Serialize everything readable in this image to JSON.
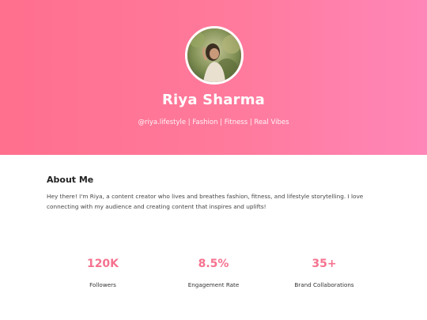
{
  "profile": {
    "name": "Riya Sharma",
    "tagline": "@riya.lifestyle | Fashion | Fitness | Real Vibes",
    "avatar_alt": "avatar photo"
  },
  "about": {
    "title": "About Me",
    "text": "Hey there! I'm Riya, a content creator who lives and breathes fashion, fitness, and lifestyle storytelling. I love connecting with my audience and creating content that inspires and uplifts!"
  },
  "stats": [
    {
      "value": "120K",
      "label": "Followers"
    },
    {
      "value": "8.5%",
      "label": "Engagement Rate"
    },
    {
      "value": "35+",
      "label": "Brand Collaborations"
    }
  ],
  "colors": {
    "gradient_start": "#ff6f8e",
    "gradient_end": "#ff86b8",
    "accent": "#f5728f"
  }
}
